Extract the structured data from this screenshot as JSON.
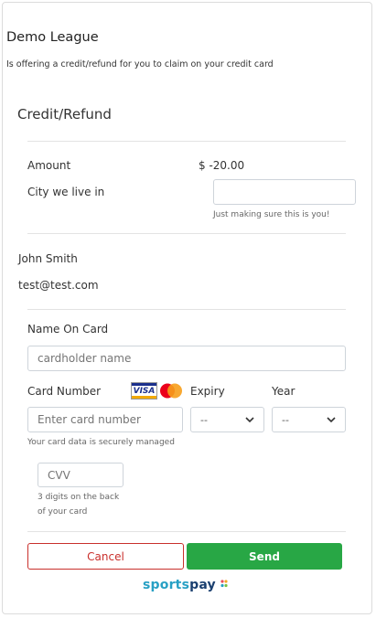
{
  "header": {
    "league_name": "Demo League",
    "offer_text": "Is offering a credit/refund for you to claim on your credit card"
  },
  "section": {
    "title": "Credit/Refund"
  },
  "amount": {
    "label": "Amount",
    "value": "$ -20.00"
  },
  "city": {
    "label": "City we live in",
    "value": "",
    "help": "Just making sure this is you!"
  },
  "user": {
    "name": "John Smith",
    "email": "test@test.com"
  },
  "card": {
    "name_label": "Name On Card",
    "name_placeholder": "cardholder name",
    "number_label": "Card Number",
    "number_placeholder": "Enter card number",
    "secure_note": "Your card data is securely managed",
    "expiry_label": "Expiry",
    "expiry_value": "--",
    "year_label": "Year",
    "year_value": "--",
    "cvv_placeholder": "CVV",
    "cvv_help_line1": "3 digits on the back",
    "cvv_help_line2": "of your card",
    "brand_icons": [
      "visa-icon",
      "mastercard-icon"
    ]
  },
  "actions": {
    "cancel_label": "Cancel",
    "send_label": "Send"
  },
  "footer": {
    "logo_part1": "sports",
    "logo_part2": "pay"
  },
  "colors": {
    "cancel": "#c9302c",
    "send": "#28a745",
    "logo_sports": "#27a0c4",
    "logo_pay": "#1a3f6f"
  }
}
